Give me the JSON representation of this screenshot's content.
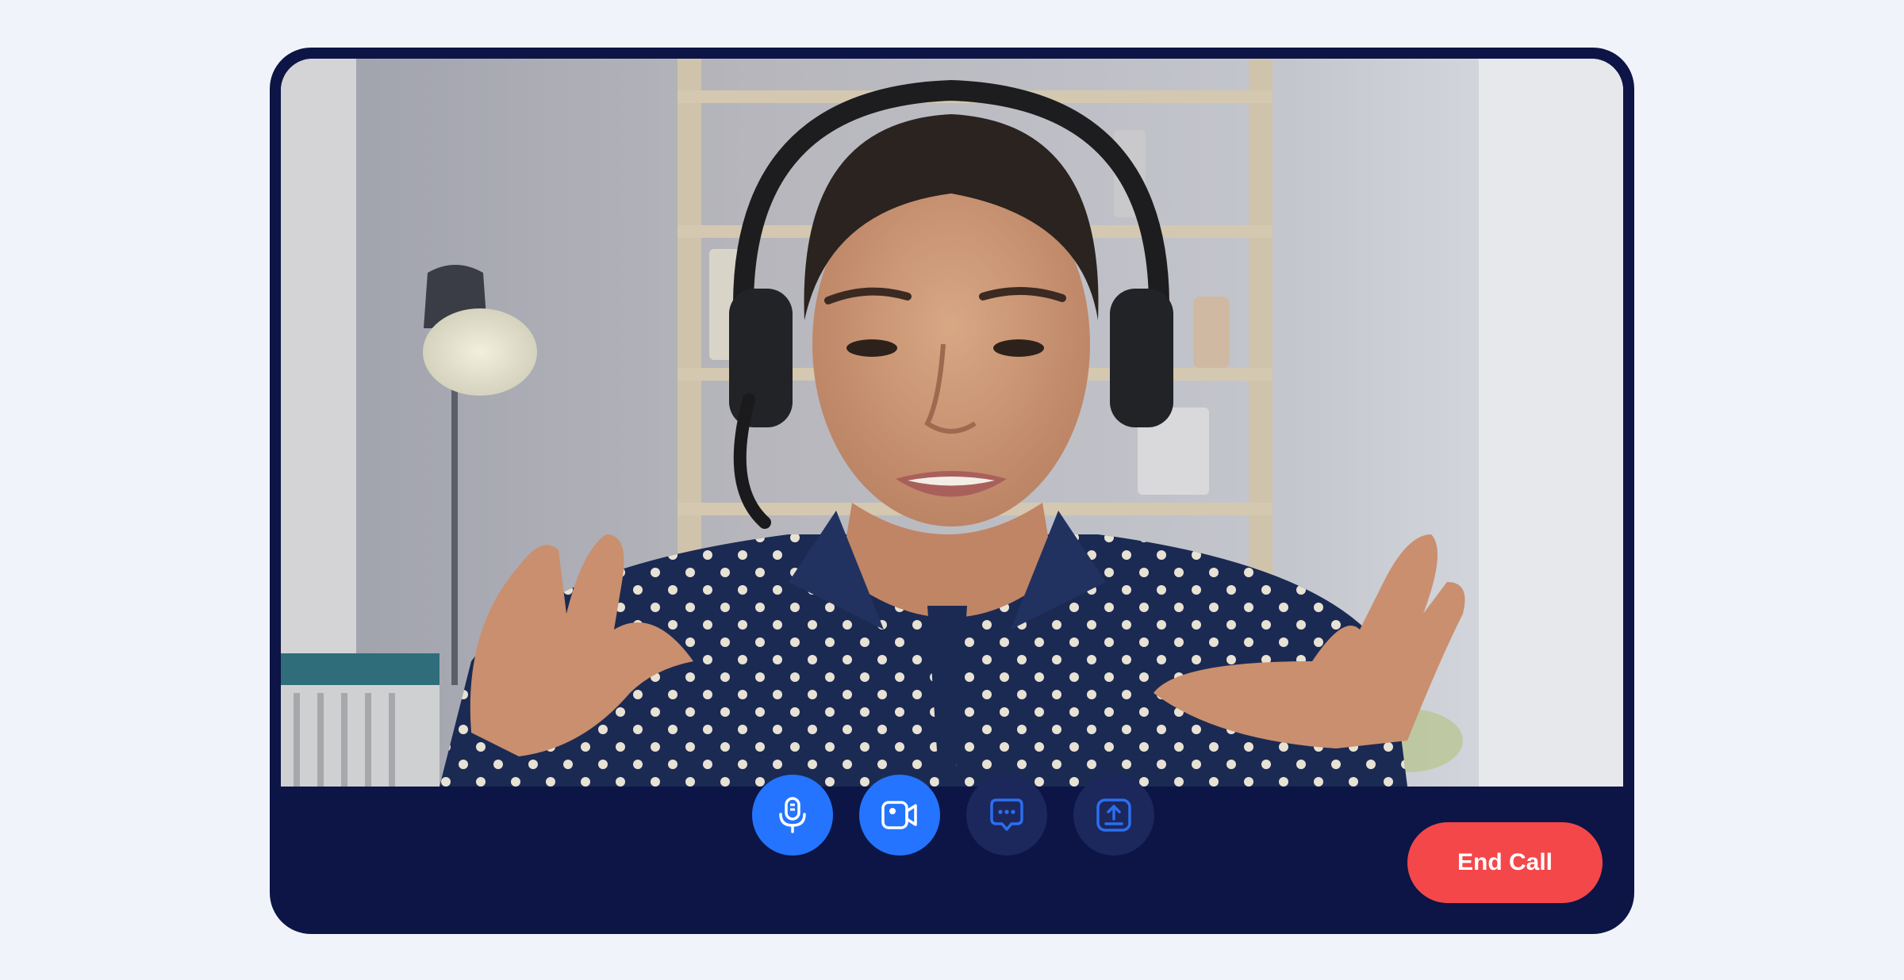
{
  "controls": {
    "mic": {
      "icon": "microphone-icon",
      "state": "on"
    },
    "camera": {
      "icon": "video-camera-icon",
      "state": "on"
    },
    "chat": {
      "icon": "chat-icon",
      "state": "off"
    },
    "share": {
      "icon": "share-screen-icon",
      "state": "off"
    },
    "end_call_label": "End Call"
  },
  "colors": {
    "page_background": "#f1f3fb",
    "window_background": "#0c1545",
    "active_button": "#2474ff",
    "inactive_button": "#1c275c",
    "inactive_icon": "#2b6ef0",
    "end_call": "#f4474a"
  }
}
